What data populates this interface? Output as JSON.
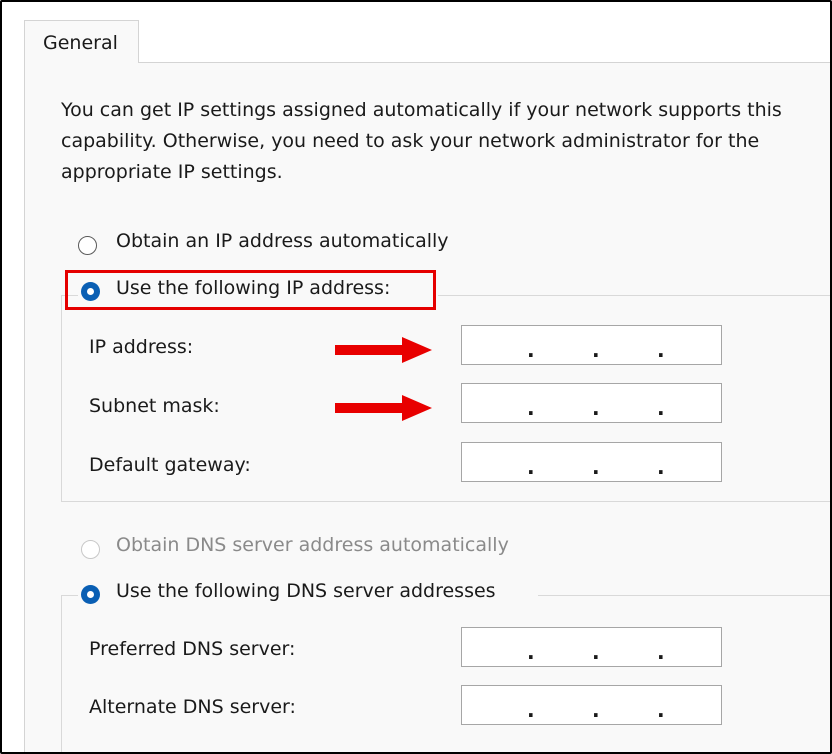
{
  "tab": {
    "label": "General"
  },
  "description": "You can get IP settings assigned automatically if your network supports this capability. Otherwise, you need to ask your network administrator for the appropriate IP settings.",
  "ip_section": {
    "auto_label": "Obtain an IP address automatically",
    "manual_label": "Use the following IP address:",
    "selected": "manual",
    "fields": [
      {
        "label": "IP address:",
        "value": ". . ."
      },
      {
        "label": "Subnet mask:",
        "value": ". . ."
      },
      {
        "label": "Default gateway:",
        "value": ". . ."
      }
    ]
  },
  "dns_section": {
    "auto_label": "Obtain DNS server address automatically",
    "auto_disabled": true,
    "manual_label": "Use the following DNS server addresses",
    "selected": "manual",
    "fields": [
      {
        "label": "Preferred DNS server:",
        "value": ". . ."
      },
      {
        "label": "Alternate DNS server:",
        "value": ". . ."
      }
    ]
  },
  "annotations": {
    "highlight_color": "#e50000",
    "arrow_color": "#e80000"
  }
}
